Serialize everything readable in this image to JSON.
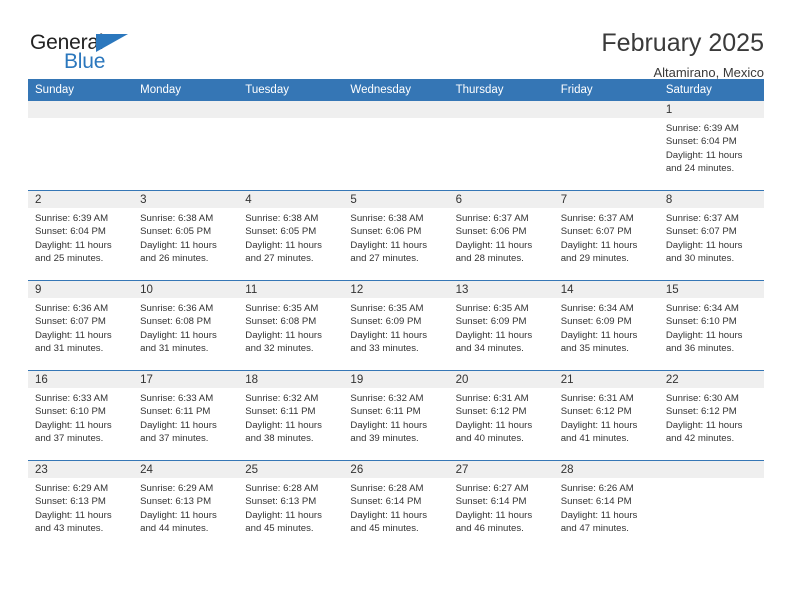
{
  "logo": {
    "word_top": "General",
    "word_bottom": "Blue",
    "triangle": "blue-triangle-icon",
    "accent_color": "#2b77bd"
  },
  "header": {
    "title": "February 2025",
    "subtitle": "Altamirano, Mexico",
    "header_bg_color": "#3576b5",
    "daynum_bg_color": "#efefef"
  },
  "weekday_headers": [
    "Sunday",
    "Monday",
    "Tuesday",
    "Wednesday",
    "Thursday",
    "Friday",
    "Saturday"
  ],
  "weeks": [
    [
      {
        "day": "",
        "lines": []
      },
      {
        "day": "",
        "lines": []
      },
      {
        "day": "",
        "lines": []
      },
      {
        "day": "",
        "lines": []
      },
      {
        "day": "",
        "lines": []
      },
      {
        "day": "",
        "lines": []
      },
      {
        "day": "1",
        "lines": [
          "Sunrise: 6:39 AM",
          "Sunset: 6:04 PM",
          "Daylight: 11 hours",
          "and 24 minutes."
        ]
      }
    ],
    [
      {
        "day": "2",
        "lines": [
          "Sunrise: 6:39 AM",
          "Sunset: 6:04 PM",
          "Daylight: 11 hours",
          "and 25 minutes."
        ]
      },
      {
        "day": "3",
        "lines": [
          "Sunrise: 6:38 AM",
          "Sunset: 6:05 PM",
          "Daylight: 11 hours",
          "and 26 minutes."
        ]
      },
      {
        "day": "4",
        "lines": [
          "Sunrise: 6:38 AM",
          "Sunset: 6:05 PM",
          "Daylight: 11 hours",
          "and 27 minutes."
        ]
      },
      {
        "day": "5",
        "lines": [
          "Sunrise: 6:38 AM",
          "Sunset: 6:06 PM",
          "Daylight: 11 hours",
          "and 27 minutes."
        ]
      },
      {
        "day": "6",
        "lines": [
          "Sunrise: 6:37 AM",
          "Sunset: 6:06 PM",
          "Daylight: 11 hours",
          "and 28 minutes."
        ]
      },
      {
        "day": "7",
        "lines": [
          "Sunrise: 6:37 AM",
          "Sunset: 6:07 PM",
          "Daylight: 11 hours",
          "and 29 minutes."
        ]
      },
      {
        "day": "8",
        "lines": [
          "Sunrise: 6:37 AM",
          "Sunset: 6:07 PM",
          "Daylight: 11 hours",
          "and 30 minutes."
        ]
      }
    ],
    [
      {
        "day": "9",
        "lines": [
          "Sunrise: 6:36 AM",
          "Sunset: 6:07 PM",
          "Daylight: 11 hours",
          "and 31 minutes."
        ]
      },
      {
        "day": "10",
        "lines": [
          "Sunrise: 6:36 AM",
          "Sunset: 6:08 PM",
          "Daylight: 11 hours",
          "and 31 minutes."
        ]
      },
      {
        "day": "11",
        "lines": [
          "Sunrise: 6:35 AM",
          "Sunset: 6:08 PM",
          "Daylight: 11 hours",
          "and 32 minutes."
        ]
      },
      {
        "day": "12",
        "lines": [
          "Sunrise: 6:35 AM",
          "Sunset: 6:09 PM",
          "Daylight: 11 hours",
          "and 33 minutes."
        ]
      },
      {
        "day": "13",
        "lines": [
          "Sunrise: 6:35 AM",
          "Sunset: 6:09 PM",
          "Daylight: 11 hours",
          "and 34 minutes."
        ]
      },
      {
        "day": "14",
        "lines": [
          "Sunrise: 6:34 AM",
          "Sunset: 6:09 PM",
          "Daylight: 11 hours",
          "and 35 minutes."
        ]
      },
      {
        "day": "15",
        "lines": [
          "Sunrise: 6:34 AM",
          "Sunset: 6:10 PM",
          "Daylight: 11 hours",
          "and 36 minutes."
        ]
      }
    ],
    [
      {
        "day": "16",
        "lines": [
          "Sunrise: 6:33 AM",
          "Sunset: 6:10 PM",
          "Daylight: 11 hours",
          "and 37 minutes."
        ]
      },
      {
        "day": "17",
        "lines": [
          "Sunrise: 6:33 AM",
          "Sunset: 6:11 PM",
          "Daylight: 11 hours",
          "and 37 minutes."
        ]
      },
      {
        "day": "18",
        "lines": [
          "Sunrise: 6:32 AM",
          "Sunset: 6:11 PM",
          "Daylight: 11 hours",
          "and 38 minutes."
        ]
      },
      {
        "day": "19",
        "lines": [
          "Sunrise: 6:32 AM",
          "Sunset: 6:11 PM",
          "Daylight: 11 hours",
          "and 39 minutes."
        ]
      },
      {
        "day": "20",
        "lines": [
          "Sunrise: 6:31 AM",
          "Sunset: 6:12 PM",
          "Daylight: 11 hours",
          "and 40 minutes."
        ]
      },
      {
        "day": "21",
        "lines": [
          "Sunrise: 6:31 AM",
          "Sunset: 6:12 PM",
          "Daylight: 11 hours",
          "and 41 minutes."
        ]
      },
      {
        "day": "22",
        "lines": [
          "Sunrise: 6:30 AM",
          "Sunset: 6:12 PM",
          "Daylight: 11 hours",
          "and 42 minutes."
        ]
      }
    ],
    [
      {
        "day": "23",
        "lines": [
          "Sunrise: 6:29 AM",
          "Sunset: 6:13 PM",
          "Daylight: 11 hours",
          "and 43 minutes."
        ]
      },
      {
        "day": "24",
        "lines": [
          "Sunrise: 6:29 AM",
          "Sunset: 6:13 PM",
          "Daylight: 11 hours",
          "and 44 minutes."
        ]
      },
      {
        "day": "25",
        "lines": [
          "Sunrise: 6:28 AM",
          "Sunset: 6:13 PM",
          "Daylight: 11 hours",
          "and 45 minutes."
        ]
      },
      {
        "day": "26",
        "lines": [
          "Sunrise: 6:28 AM",
          "Sunset: 6:14 PM",
          "Daylight: 11 hours",
          "and 45 minutes."
        ]
      },
      {
        "day": "27",
        "lines": [
          "Sunrise: 6:27 AM",
          "Sunset: 6:14 PM",
          "Daylight: 11 hours",
          "and 46 minutes."
        ]
      },
      {
        "day": "28",
        "lines": [
          "Sunrise: 6:26 AM",
          "Sunset: 6:14 PM",
          "Daylight: 11 hours",
          "and 47 minutes."
        ]
      },
      {
        "day": "",
        "lines": []
      }
    ]
  ]
}
